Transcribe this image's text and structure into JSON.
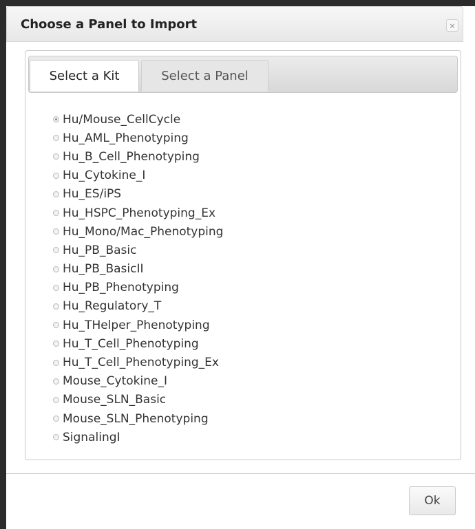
{
  "dialog": {
    "title": "Choose a Panel to Import",
    "close_icon": "close-icon",
    "close_glyph": "×"
  },
  "tabs": [
    {
      "label": "Select a Kit",
      "active": true
    },
    {
      "label": "Select a Panel",
      "active": false
    }
  ],
  "kits": [
    {
      "label": "Hu/Mouse_CellCycle",
      "selected": true
    },
    {
      "label": "Hu_AML_Phenotyping",
      "selected": false
    },
    {
      "label": "Hu_B_Cell_Phenotyping",
      "selected": false
    },
    {
      "label": "Hu_Cytokine_I",
      "selected": false
    },
    {
      "label": "Hu_ES/iPS",
      "selected": false
    },
    {
      "label": "Hu_HSPC_Phenotyping_Ex",
      "selected": false
    },
    {
      "label": "Hu_Mono/Mac_Phenotyping",
      "selected": false
    },
    {
      "label": "Hu_PB_Basic",
      "selected": false
    },
    {
      "label": "Hu_PB_BasicII",
      "selected": false
    },
    {
      "label": "Hu_PB_Phenotyping",
      "selected": false
    },
    {
      "label": "Hu_Regulatory_T",
      "selected": false
    },
    {
      "label": "Hu_THelper_Phenotyping",
      "selected": false
    },
    {
      "label": "Hu_T_Cell_Phenotyping",
      "selected": false
    },
    {
      "label": "Hu_T_Cell_Phenotyping_Ex",
      "selected": false
    },
    {
      "label": "Mouse_Cytokine_I",
      "selected": false
    },
    {
      "label": "Mouse_SLN_Basic",
      "selected": false
    },
    {
      "label": "Mouse_SLN_Phenotyping",
      "selected": false
    },
    {
      "label": "SignalingI",
      "selected": false
    }
  ],
  "footer": {
    "ok_label": "Ok"
  }
}
